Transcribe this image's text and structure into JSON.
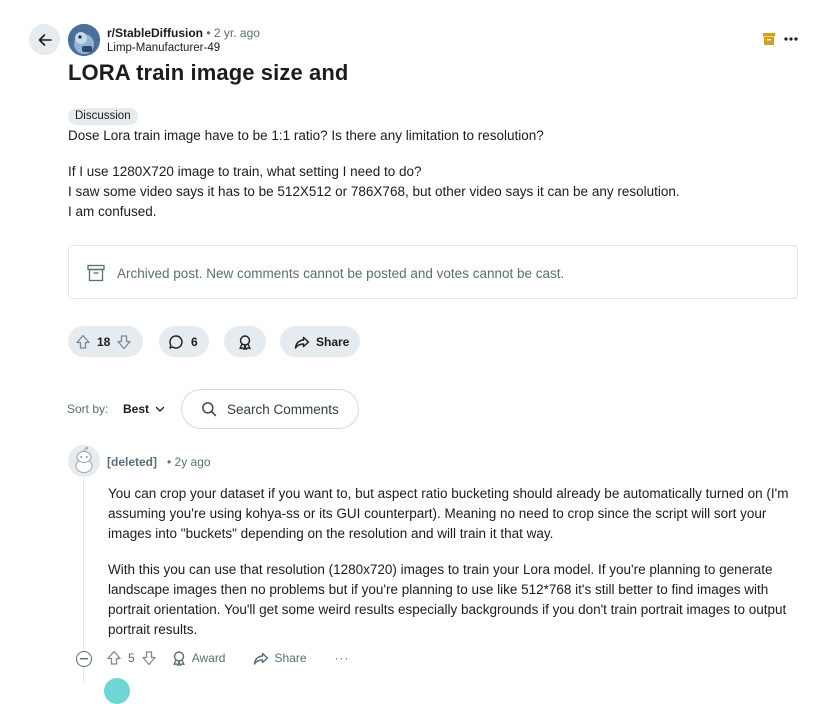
{
  "post": {
    "subreddit": "r/StableDiffusion",
    "separator": "•",
    "time": "2 yr. ago",
    "author": "Limp-Manufacturer-49",
    "title": "LORA train image size and",
    "flair": "Discussion",
    "body": [
      "Dose Lora train image have to be 1:1 ratio? Is there any limitation to resolution?",
      "If I use 1280X720 image to train, what setting I need to do?",
      "I saw some video says it has to be 512X512 or 786X768, but other video says it can be any resolution.",
      "I am confused."
    ],
    "archived_notice": "Archived post. New comments cannot be posted and votes cannot be cast.",
    "vote_count": "18",
    "comment_count": "6",
    "share_label": "Share"
  },
  "sort": {
    "label": "Sort by:",
    "value": "Best"
  },
  "search": {
    "placeholder": "Search Comments"
  },
  "comment": {
    "author": "[deleted]",
    "time": "• 2y ago",
    "paragraphs": [
      "You can crop your dataset if you want to, but aspect ratio bucketing should already be automatically turned on (I'm assuming you're using kohya-ss or its GUI counterpart). Meaning no need to crop since the script will sort your images into \"buckets\" depending on the resolution and will train it that way.",
      "With this you can use that resolution (1280x720) images to train your Lora model. If you're planning to generate landscape images then no problems but if you're planning to use like 512*768 it's still better to find images with portrait orientation. You'll get some weird results especially backgrounds if you don't train portrait images to output portrait results."
    ],
    "vote_count": "5",
    "award_label": "Award",
    "share_label": "Share",
    "more_label": "···"
  },
  "colors": {
    "pill_bg": "#e5ebee",
    "muted_text": "#576f76",
    "archive_badge": "#d4a017"
  },
  "icons": [
    "back-arrow-icon",
    "archive-icon",
    "more-icon",
    "upvote-icon",
    "downvote-icon",
    "comment-icon",
    "award-icon",
    "share-icon",
    "chevron-down-icon",
    "search-icon",
    "snoo-avatar-icon",
    "collapse-icon"
  ]
}
